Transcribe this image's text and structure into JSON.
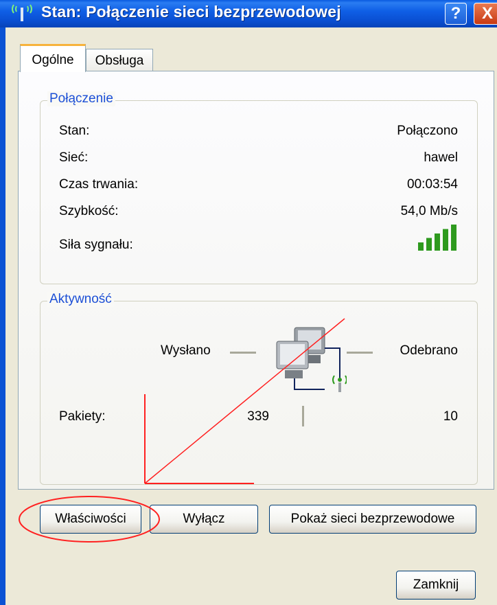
{
  "window": {
    "title": "Stan: Połączenie sieci bezprzewodowej",
    "help_label": "?",
    "close_label": "X"
  },
  "tabs": [
    {
      "label": "Ogólne",
      "active": true
    },
    {
      "label": "Obsługa",
      "active": false
    }
  ],
  "connection": {
    "group_title": "Połączenie",
    "rows": [
      {
        "label": "Stan:",
        "value": "Połączono"
      },
      {
        "label": "Sieć:",
        "value": "hawel"
      },
      {
        "label": "Czas trwania:",
        "value": "00:03:54"
      },
      {
        "label": "Szybkość:",
        "value": "54,0 Mb/s"
      }
    ],
    "signal_label": "Siła sygnału:",
    "signal_bars_lit": 5,
    "signal_bars_total": 5,
    "signal_color": "#2e9a1e"
  },
  "activity": {
    "group_title": "Aktywność",
    "sent_label": "Wysłano",
    "received_label": "Odebrano",
    "packets_label": "Pakiety:",
    "packets_sent": "339",
    "packets_received": "10"
  },
  "buttons": {
    "properties": "Właściwości",
    "disable": "Wyłącz",
    "show_networks": "Pokaż sieci bezprzewodowe",
    "close": "Zamknij"
  },
  "colors": {
    "titlebar": "#0a5be0",
    "group_title": "#1c4fd6",
    "annotation": "#ff0000"
  }
}
